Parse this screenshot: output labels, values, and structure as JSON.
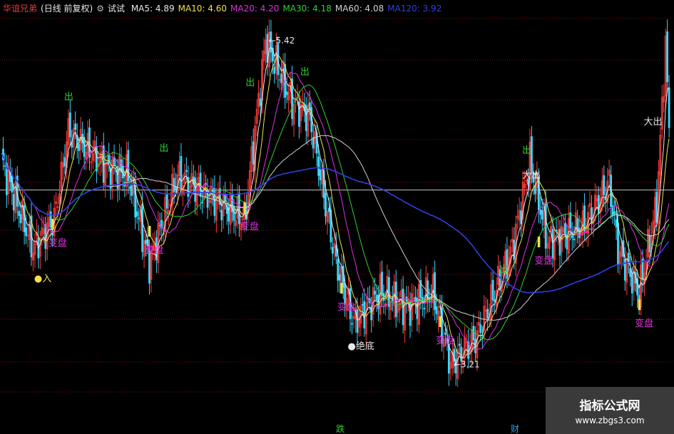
{
  "header": {
    "stock_name": "华谊兄弟",
    "period": "(日线 前复权)",
    "indicator_icon": "gear-icon",
    "indicator_name": "试试",
    "ma": [
      {
        "label": "MA5:",
        "value": "4.89",
        "color": "#e8e8e8"
      },
      {
        "label": "MA10:",
        "value": "4.60",
        "color": "#f0e050"
      },
      {
        "label": "MA20:",
        "value": "4.20",
        "color": "#e030e0"
      },
      {
        "label": "MA30:",
        "value": "4.18",
        "color": "#30d030"
      },
      {
        "label": "MA60:",
        "value": "4.08",
        "color": "#d0d0d0"
      },
      {
        "label": "MA120:",
        "value": "3.92",
        "color": "#3040e0"
      }
    ]
  },
  "watermark": {
    "title": "指标公式网",
    "url": "www.zbgs3.com"
  },
  "chart_data": {
    "type": "candlestick",
    "price_range": [
      2.9,
      5.6
    ],
    "reference_line": 4.4,
    "price_labels": [
      {
        "i": 150,
        "text": "5.42",
        "value": 5.42
      },
      {
        "i": 255,
        "text": "3.21",
        "value": 3.21
      }
    ],
    "signals": [
      {
        "text": "出",
        "i": 38,
        "color": "#30d030"
      },
      {
        "text": "出",
        "i": 92,
        "color": "#30d030"
      },
      {
        "text": "出",
        "i": 141,
        "color": "#30d030"
      },
      {
        "text": "出",
        "i": 172,
        "color": "#30d030"
      },
      {
        "text": "出",
        "i": 285,
        "color": "#30d030"
      },
      {
        "text": "出",
        "i": 298,
        "color": "#30d030"
      },
      {
        "text": "大出",
        "i": 298,
        "color": "#e8e8e8"
      },
      {
        "text": "大出",
        "i": 367,
        "color": "#e8e8e8"
      },
      {
        "text": "变盘",
        "i": 29,
        "color": "#e030e0"
      },
      {
        "text": "变盘",
        "i": 84,
        "color": "#e030e0"
      },
      {
        "text": "变盘",
        "i": 138,
        "color": "#e030e0"
      },
      {
        "text": "变盘",
        "i": 193,
        "color": "#e030e0"
      },
      {
        "text": "变盘",
        "i": 249,
        "color": "#e030e0"
      },
      {
        "text": "变盘",
        "i": 305,
        "color": "#e030e0"
      },
      {
        "text": "变盘",
        "i": 362,
        "color": "#e030e0"
      },
      {
        "text": "●入",
        "i": 21,
        "color": "#f0e050"
      },
      {
        "text": "●绝底",
        "i": 199,
        "color": "#e8e8e8"
      }
    ],
    "bottom_marks": [
      {
        "text": "跌",
        "i": 190,
        "color": "#30d030"
      },
      {
        "text": "财",
        "i": 289,
        "color": "#30a0e0"
      }
    ]
  }
}
